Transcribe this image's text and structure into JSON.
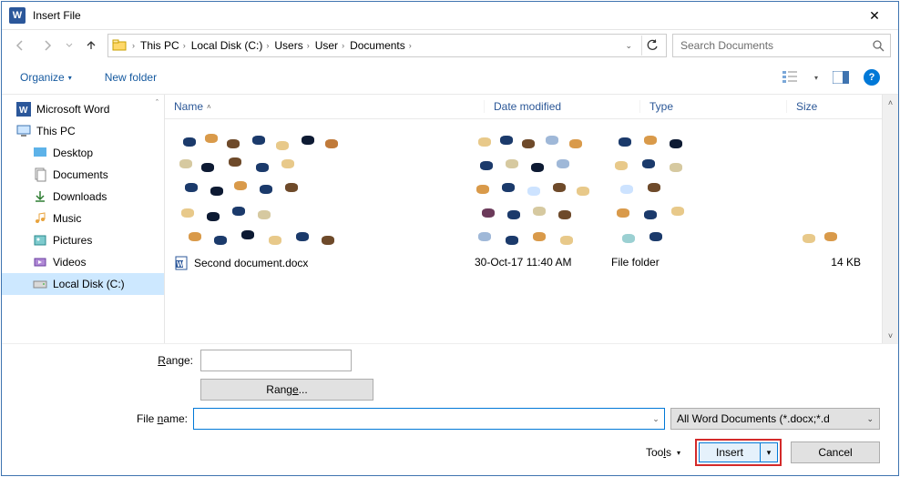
{
  "window": {
    "title": "Insert File"
  },
  "breadcrumbs": {
    "b0": "This PC",
    "b1": "Local Disk (C:)",
    "b2": "Users",
    "b3": "User",
    "b4": "Documents"
  },
  "search": {
    "placeholder": "Search Documents"
  },
  "toolbar": {
    "organize": "Organize",
    "newfolder": "New folder"
  },
  "tree": {
    "word": "Microsoft Word",
    "thispc": "This PC",
    "desktop": "Desktop",
    "documents": "Documents",
    "downloads": "Downloads",
    "music": "Music",
    "pictures": "Pictures",
    "videos": "Videos",
    "localdisk": "Local Disk (C:)"
  },
  "columns": {
    "name": "Name",
    "date": "Date modified",
    "type": "Type",
    "size": "Size"
  },
  "file": {
    "name": "Second document.docx",
    "date": "30-Oct-17 11:40 AM",
    "type": "File folder",
    "size": "14 KB"
  },
  "bottom": {
    "range_label": "Range:",
    "range_btn": "Range...",
    "filename_label": "File name:",
    "filter": "All Word Documents (*.docx;*.d",
    "tools": "Tools",
    "insert": "Insert",
    "cancel": "Cancel"
  }
}
